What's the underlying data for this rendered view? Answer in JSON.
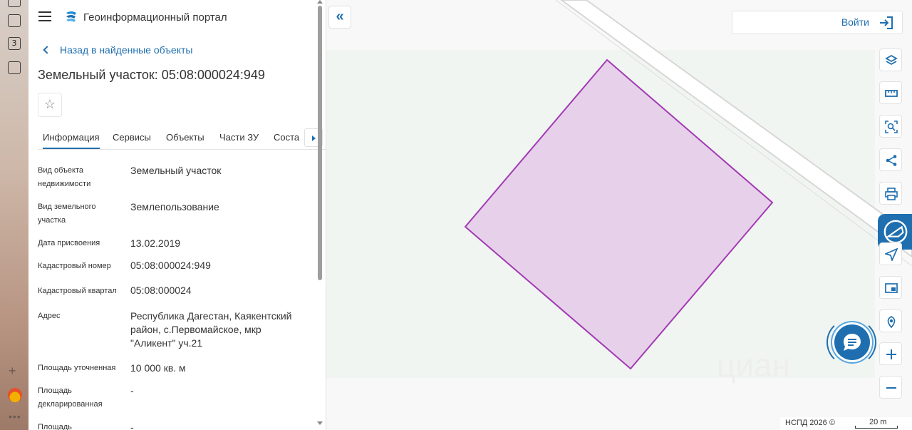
{
  "portal": {
    "title": "Геоинформационный портал"
  },
  "panel": {
    "back_label": "Назад в найденные объекты",
    "object_title": "Земельный участок: 05:08:000024:949",
    "tabs": [
      "Информация",
      "Сервисы",
      "Объекты",
      "Части ЗУ",
      "Соста"
    ],
    "rows": [
      {
        "label": "Вид объекта недвижимости",
        "value": "Земельный участок"
      },
      {
        "label": "Вид земельного участка",
        "value": "Землепользование"
      },
      {
        "label": "Дата присвоения",
        "value": "13.02.2019"
      },
      {
        "label": "Кадастровый номер",
        "value": "05:08:000024:949"
      },
      {
        "label": "Кадастровый квартал",
        "value": "05:08:000024"
      },
      {
        "label": "Адрес",
        "value": "Республика Дагестан, Каякентский район, с.Первомайское, мкр \"Аликент\" уч.21"
      },
      {
        "label": "Площадь уточненная",
        "value": "10 000 кв. м"
      },
      {
        "label": "Площадь декларированная",
        "value": "-"
      },
      {
        "label": "Площадь",
        "value": "-"
      }
    ]
  },
  "map": {
    "login_label": "Войти",
    "attribution": "НСПД 2026 ©",
    "scale_label": "20 m",
    "watermark": "циан",
    "tools": [
      "layers-icon",
      "ruler-icon",
      "search-area-icon",
      "share-icon",
      "print-icon",
      "nspd-logo-icon",
      "navigate-icon",
      "picture-in-picture-icon",
      "location-icon",
      "zoom-in-icon",
      "zoom-out-icon"
    ],
    "colors": {
      "parcel_fill": "#e6cde9",
      "parcel_stroke": "#a23ab4",
      "accent": "#1f6fb0"
    }
  }
}
